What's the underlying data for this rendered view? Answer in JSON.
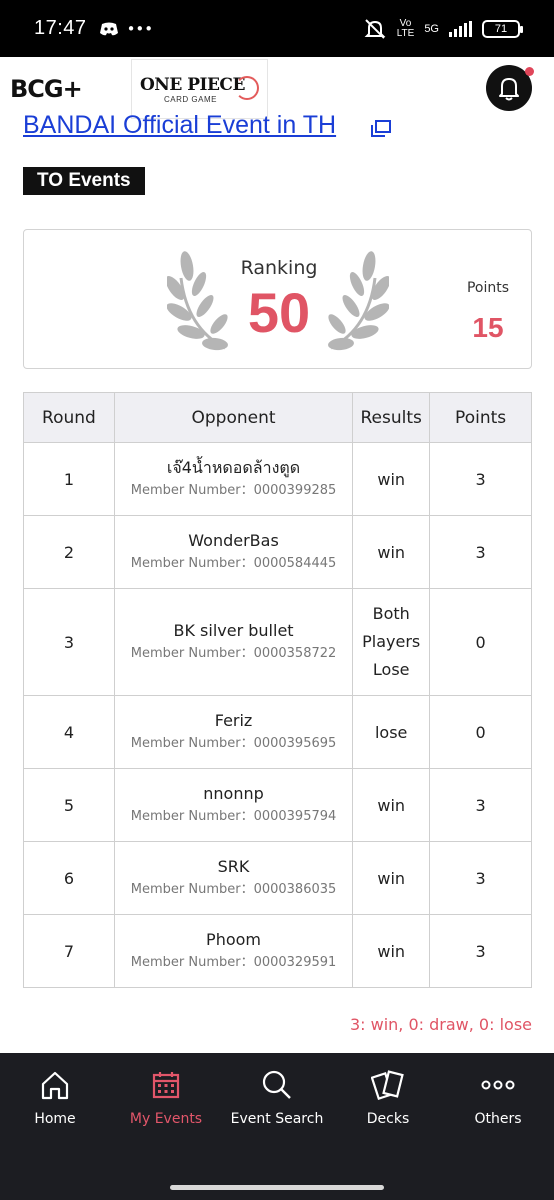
{
  "status_bar": {
    "time": "17:47",
    "network_left": "Vo",
    "network_left2": "LTE",
    "network_type": "5G",
    "battery": "71",
    "icons": [
      "discord-icon",
      "more-dots-icon",
      "mute-icon",
      "signal-icon",
      "battery-icon"
    ]
  },
  "app": {
    "brand_logo": "BCG+",
    "game_logo_main": "ONE PIECE",
    "game_logo_sub": "CARD GAME",
    "notification_icon": "bell-icon"
  },
  "event": {
    "title": "BANDAI Official Event in TH",
    "badge": "TO Events"
  },
  "ranking": {
    "label": "Ranking",
    "value": "50",
    "points_label": "Points",
    "points_value": "15"
  },
  "table": {
    "headers": [
      "Round",
      "Opponent",
      "Results",
      "Points"
    ],
    "member_prefix": "Member Number：",
    "rows": [
      {
        "round": "1",
        "opponent": "เจ๊4น้ำหดอดล้างตูด",
        "member": "Member Number：0000399285",
        "result": "win",
        "points": "3"
      },
      {
        "round": "2",
        "opponent": "WonderBas",
        "member": "Member Number：0000584445",
        "result": "win",
        "points": "3"
      },
      {
        "round": "3",
        "opponent": "BK silver bullet",
        "member": "Member Number：0000358722",
        "result": "Both Players Lose",
        "points": "0"
      },
      {
        "round": "4",
        "opponent": "Feriz",
        "member": "Member Number：0000395695",
        "result": "lose",
        "points": "0"
      },
      {
        "round": "5",
        "opponent": "nnonnp",
        "member": "Member Number：0000395794",
        "result": "win",
        "points": "3"
      },
      {
        "round": "6",
        "opponent": "SRK",
        "member": "Member Number：0000386035",
        "result": "win",
        "points": "3"
      },
      {
        "round": "7",
        "opponent": "Phoom",
        "member": "Member Number：0000329591",
        "result": "win",
        "points": "3"
      }
    ],
    "legend": "3: win, 0: draw, 0: lose"
  },
  "nav": {
    "items": [
      {
        "label": "Home",
        "icon": "home-icon",
        "active": false
      },
      {
        "label": "My Events",
        "icon": "calendar-icon",
        "active": true
      },
      {
        "label": "Event Search",
        "icon": "search-icon",
        "active": false
      },
      {
        "label": "Decks",
        "icon": "cards-icon",
        "active": false
      },
      {
        "label": "Others",
        "icon": "more-icon",
        "active": false
      }
    ]
  },
  "colors": {
    "accent": "#e05565",
    "link": "#1a3ed6",
    "nav_bg": "#1c1d22",
    "status_bg": "#000000"
  }
}
